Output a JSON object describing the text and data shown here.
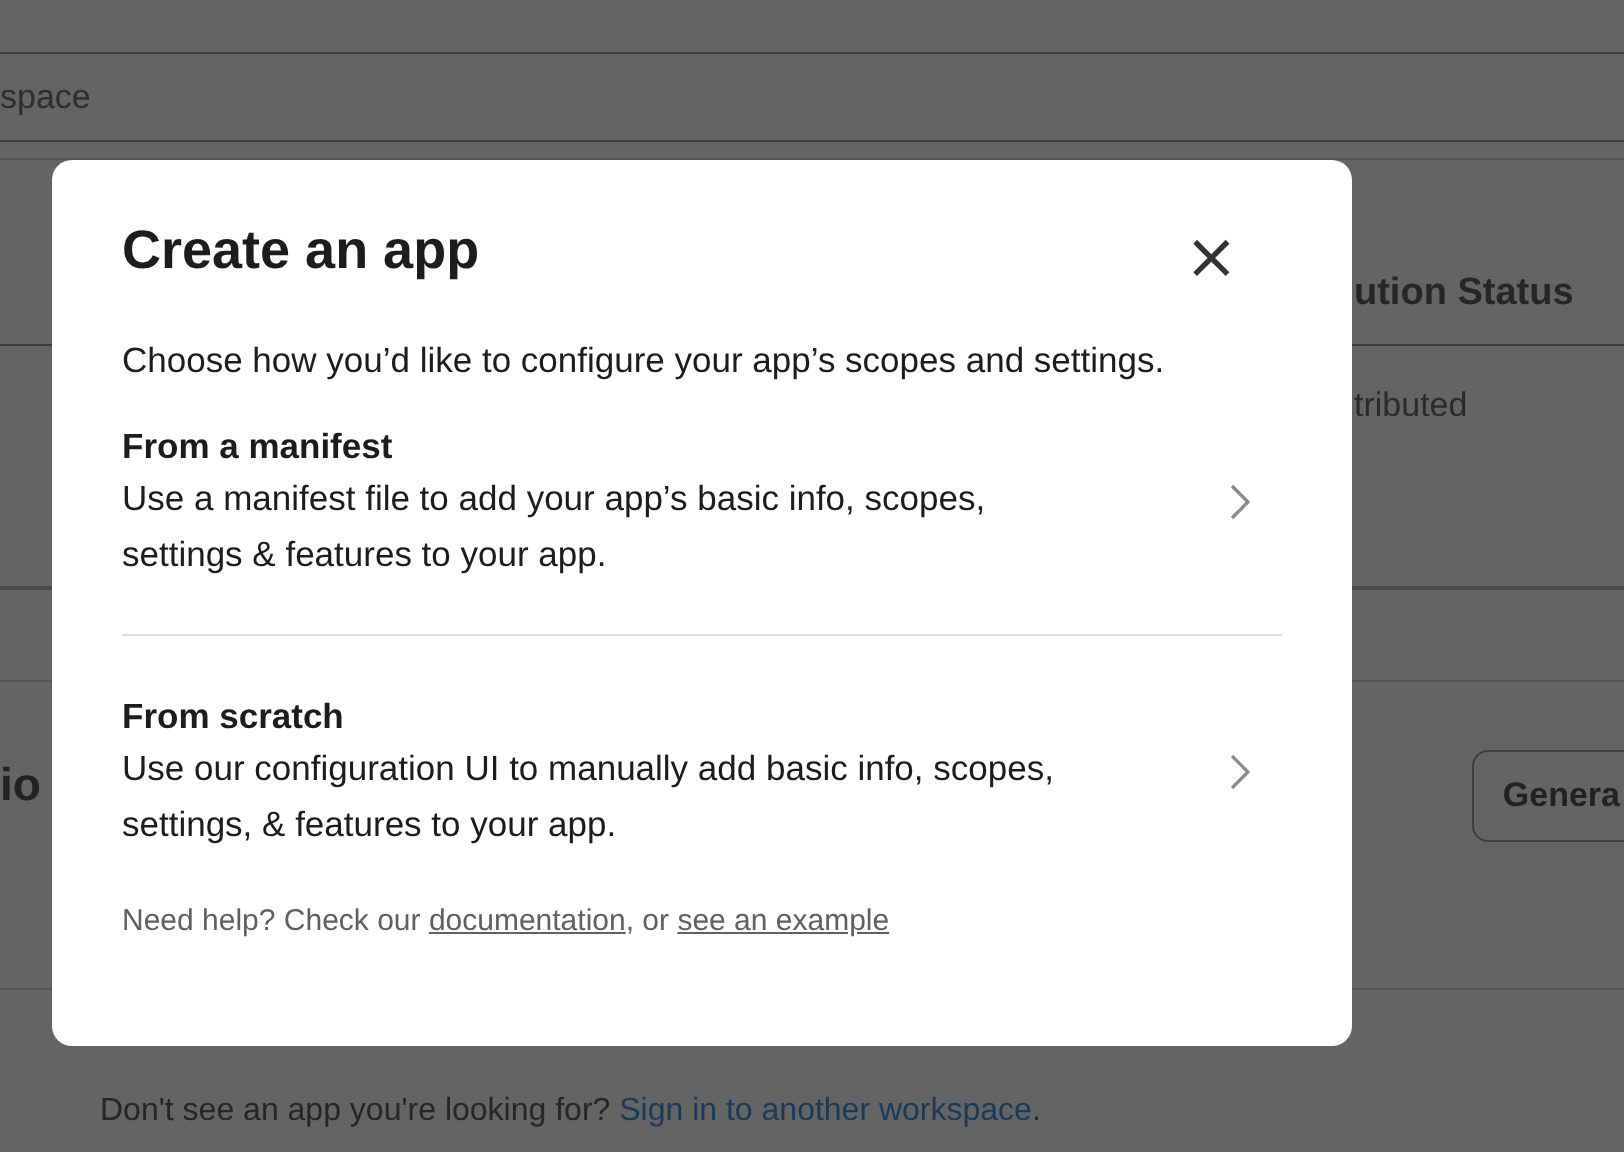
{
  "background": {
    "field_text": "space",
    "table": {
      "column_header": "ution Status",
      "cell": "tributed"
    },
    "section_heading": "io",
    "button": "Genera",
    "footer": [
      {
        "kind": "text",
        "text": "Don't see an app you're looking for? "
      },
      {
        "kind": "link",
        "text": "Sign in to another workspace"
      },
      {
        "kind": "text",
        "text": "."
      }
    ]
  },
  "dialog": {
    "title": "Create an app",
    "close": "×",
    "subtitle": "Choose how you’d like to configure your app’s scopes and settings.",
    "options": [
      {
        "title": "From a manifest",
        "description": "Use a manifest file to add your app’s basic info, scopes, settings & features to your app."
      },
      {
        "title": "From scratch",
        "description": "Use our configuration UI to manually add basic info, scopes, settings, & features to your app."
      }
    ],
    "help": [
      {
        "kind": "text",
        "text": "Need help? Check our "
      },
      {
        "kind": "link",
        "text": "documentation"
      },
      {
        "kind": "text",
        "text": ", or "
      },
      {
        "kind": "link",
        "text": "see an example"
      }
    ]
  }
}
